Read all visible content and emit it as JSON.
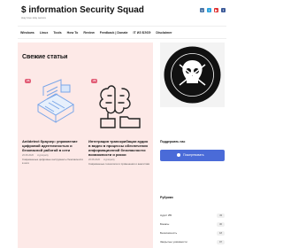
{
  "header": {
    "site_title": "$ information Security Squad",
    "tagline": "stay love stay secure"
  },
  "social": [
    {
      "icon": "vk-icon",
      "color": "#4a76a8"
    },
    {
      "icon": "telegram-icon",
      "color": "#2aa3df"
    },
    {
      "icon": "youtube-icon",
      "color": "#e03030"
    },
    {
      "icon": "facebook-icon",
      "color": "#3b5998"
    }
  ],
  "nav": {
    "items": [
      "Windows",
      "Linux",
      "Tools",
      "How To",
      "Review",
      "Feedback | Donate",
      "IT ИЗ БЭЗЭ",
      "Disclaimer"
    ]
  },
  "main": {
    "section_title": "Свежие статьи",
    "cards": [
      {
        "badge": "ИБ",
        "title": "Antidetect браузер: управление цифровой идентичностью и безопасной работой в сети",
        "date": "20.08.2026",
        "author": "cryptoparty",
        "excerpt": "Современные цифровые инструменты безопасности в сети"
      },
      {
        "badge": "ИБ",
        "title": "Интеграция транскрибации аудио в видео в процессы обеспечения информационной безопасности: возможности и риски",
        "date": "20.08.2026",
        "author": "cryptoparty",
        "excerpt": "Современные технологии и применения и аналитики"
      }
    ]
  },
  "sidebar": {
    "support_title": "Поддержать нас",
    "share_button": "Пожертвовать",
    "rubrics_title": "Рубрики",
    "rubrics": [
      {
        "label": "Аудит ИБ",
        "count": "43"
      },
      {
        "label": "Бэкапы",
        "count": "36"
      },
      {
        "label": "Безопасность",
        "count": "18"
      },
      {
        "label": "Закрытые уязвимости",
        "count": "97"
      }
    ]
  },
  "colors": {
    "accent": "#e25d76",
    "panel_bg": "#fde9e7",
    "button": "#4a6bd8"
  }
}
